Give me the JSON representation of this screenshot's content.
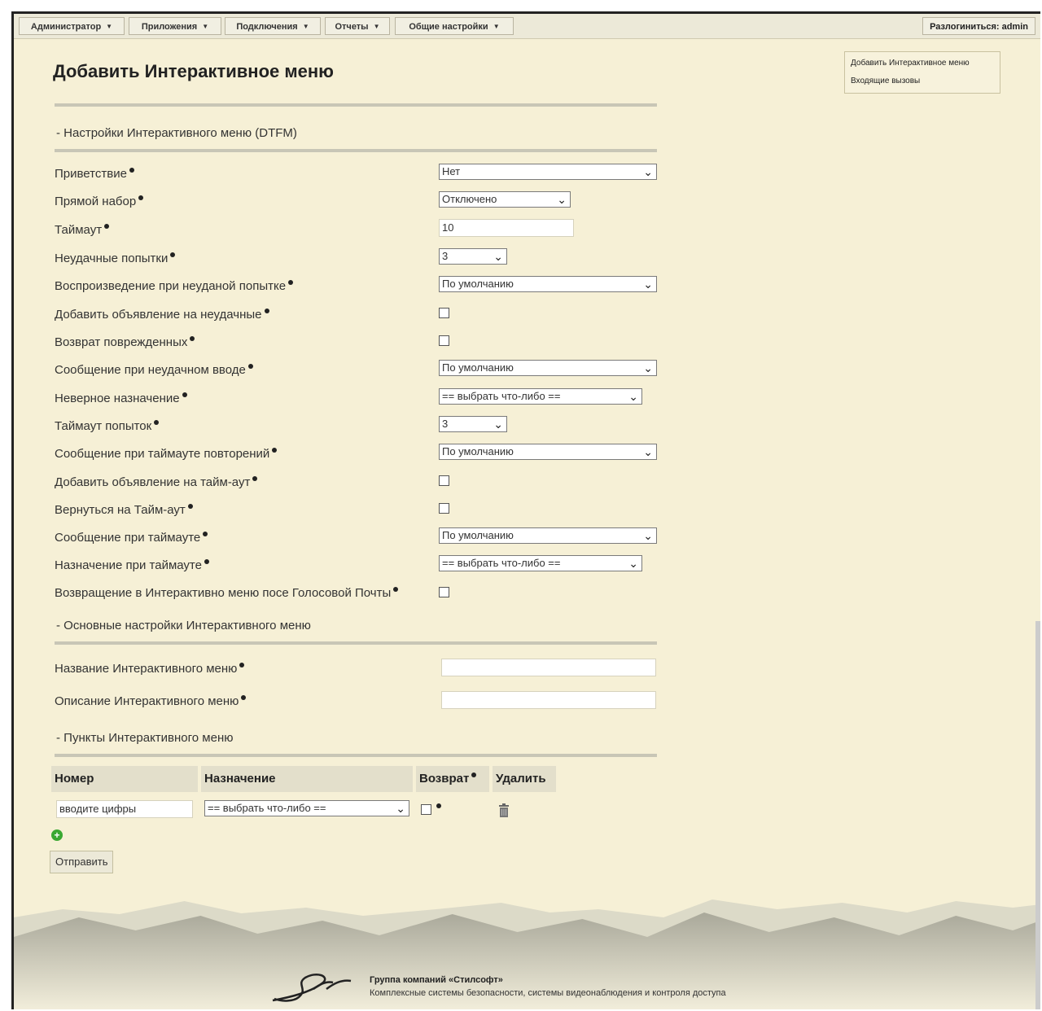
{
  "nav": {
    "items": [
      {
        "label": "Администратор"
      },
      {
        "label": "Приложения"
      },
      {
        "label": "Подключения"
      },
      {
        "label": "Отчеты"
      },
      {
        "label": "Общие настройки"
      }
    ],
    "logout_label": "Разлогиниться: admin"
  },
  "sidebar": {
    "links": [
      "Добавить Интерактивное меню",
      "Входящие вызовы"
    ]
  },
  "page_title": "Добавить Интерактивное меню",
  "sections": {
    "dtfm": "- Настройки Интерактивного меню (DTFM)",
    "basic": "- Основные настройки Интерактивного меню",
    "items": "- Пункты Интерактивного меню"
  },
  "fields": [
    {
      "label": "Приветствие",
      "value": "Нет"
    },
    {
      "label": "Прямой набор",
      "value": "Отключено"
    },
    {
      "label": "Таймаут",
      "value": "10"
    },
    {
      "label": "Неудачные попытки",
      "value": "3"
    },
    {
      "label": "Воспроизведение при неуданой попытке",
      "value": "По умолчанию"
    },
    {
      "label": "Добавить объявление на неудачные",
      "checked": false
    },
    {
      "label": "Возврат поврежденных",
      "checked": false
    },
    {
      "label": "Сообщение при неудачном вводе",
      "value": "По умолчанию"
    },
    {
      "label": "Неверное назначение",
      "value": "== выбрать что-либо =="
    },
    {
      "label": "Таймаут попыток",
      "value": "3"
    },
    {
      "label": "Сообщение при таймауте повторений",
      "value": "По умолчанию"
    },
    {
      "label": "Добавить объявление на тайм-аут",
      "checked": false
    },
    {
      "label": "Вернуться на Тайм-аут",
      "checked": false
    },
    {
      "label": "Сообщение при таймауте",
      "value": "По умолчанию"
    },
    {
      "label": "Назначение при таймауте",
      "value": "== выбрать что-либо =="
    },
    {
      "label": "Возвращение в Интерактивно меню посе Голосовой Почты",
      "checked": false
    }
  ],
  "basic_fields": [
    {
      "label": "Название Интерактивного меню",
      "value": ""
    },
    {
      "label": "Описание Интерактивного меню",
      "value": ""
    }
  ],
  "table": {
    "headers": [
      "Номер",
      "Назначение",
      "Возврат",
      "Удалить"
    ],
    "row": {
      "number": "вводите цифры",
      "destination": "== выбрать что-либо =="
    }
  },
  "submit_label": "Отправить",
  "footer": {
    "company": "Группа компаний «Стилсофт»",
    "tagline": "Комплексные системы безопасности, системы видеонаблюдения и контроля доступа"
  },
  "colors": {
    "background": "#f6f0d6",
    "nav": "#ece9d8",
    "add": "#3aa832"
  }
}
